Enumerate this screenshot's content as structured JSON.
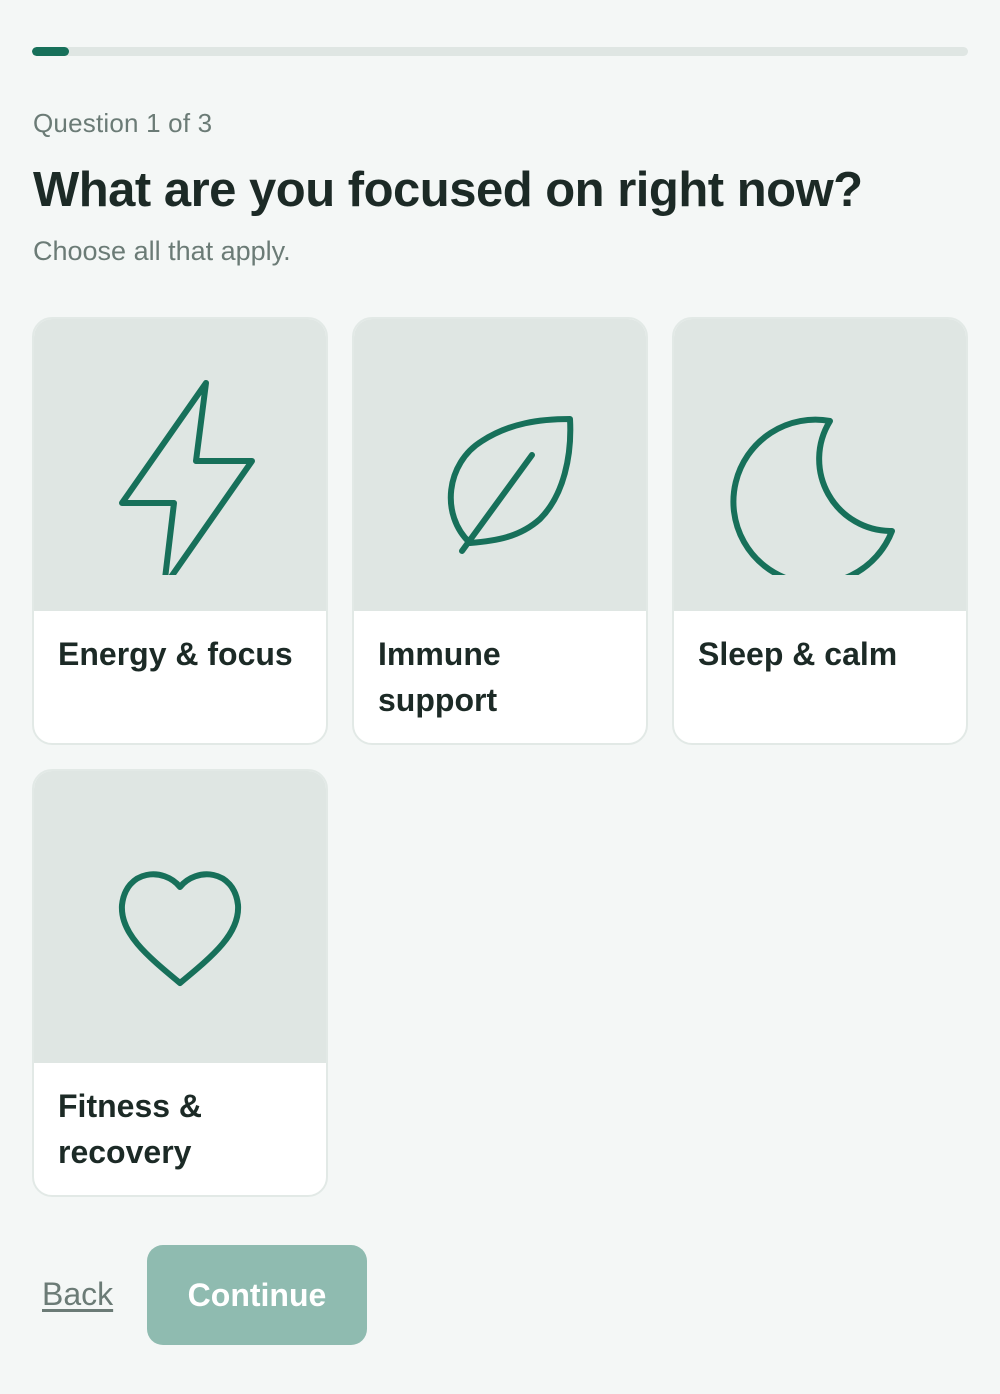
{
  "progress": {
    "fraction": 0.04
  },
  "header": {
    "counter": "Question 1 of 3",
    "title": "What are you focused on right now?",
    "subtitle": "Choose all that apply."
  },
  "options": [
    {
      "label": "Energy & focus",
      "icon": "lightning-bolt-icon"
    },
    {
      "label": "Immune support",
      "icon": "leaf-icon"
    },
    {
      "label": "Sleep & calm",
      "icon": "moon-icon"
    },
    {
      "label": "Fitness & recovery",
      "icon": "heart-icon"
    }
  ],
  "footer": {
    "back_label": "Back",
    "continue_label": "Continue"
  },
  "colors": {
    "accent": "#17705a",
    "continue_disabled": "#8fbbb0",
    "background": "#f4f7f6",
    "tile": "#dfe6e3"
  }
}
